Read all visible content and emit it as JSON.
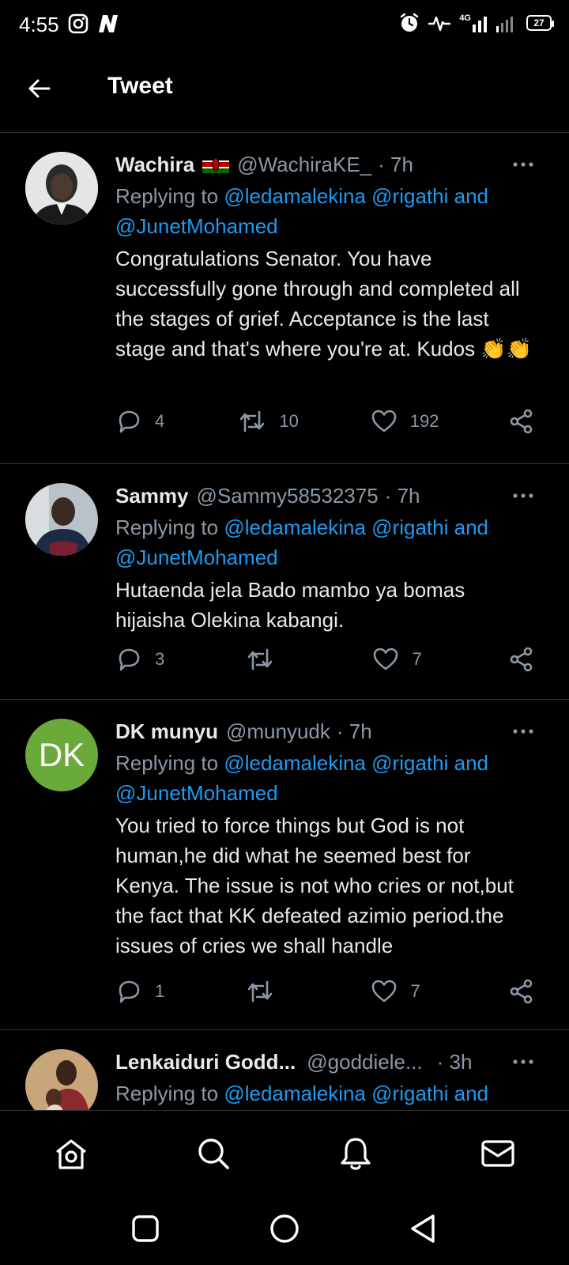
{
  "status_bar": {
    "time": "4:55",
    "network": "4G",
    "battery": "27",
    "icons": [
      "instagram-icon",
      "app-n-icon",
      "alarm-icon",
      "activity-icon",
      "signal-icon",
      "battery-icon"
    ]
  },
  "header": {
    "title": "Tweet",
    "back_icon": "arrow-left-icon"
  },
  "tweets": [
    {
      "name": "Wachira",
      "flag": "kenya-flag",
      "handle": "@WachiraKE_",
      "time": "· 7h",
      "reply_prefix": "Replying to",
      "mention1": "@ledamalekina",
      "mention2": "@rigathi",
      "reply_and": "and",
      "mention3": "@JunetMohamed",
      "body": "Congratulations Senator. You have successfully gone through and completed all the stages of grief. Acceptance is the last stage and that's where you're at. Kudos 👏👏",
      "replies": "4",
      "retweets": "10",
      "likes": "192"
    },
    {
      "name": "Sammy",
      "handle": "@Sammy58532375",
      "time": "· 7h",
      "reply_prefix": "Replying to",
      "mention1": "@ledamalekina",
      "mention2": "@rigathi",
      "reply_and": "and",
      "mention3": "@JunetMohamed",
      "body": "Hutaenda jela Bado mambo ya bomas hijaisha Olekina kabangi.",
      "replies": "3",
      "retweets": "",
      "likes": "7"
    },
    {
      "name": "DK munyu",
      "handle": "@munyudk",
      "time": "· 7h",
      "avatar_initials": "DK",
      "reply_prefix": "Replying to",
      "mention1": "@ledamalekina",
      "mention2": "@rigathi",
      "reply_and": "and",
      "mention3": "@JunetMohamed",
      "body": "You tried to force things but God is not human,he did what he seemed best for Kenya. The issue is not who cries or not,but the fact that KK defeated azimio period.the issues of cries we shall handle",
      "replies": "1",
      "retweets": "",
      "likes": "7"
    },
    {
      "name": "Lenkaiduri Godd...",
      "handle": "@goddiele...",
      "time": "· 3h",
      "reply_prefix": "Replying to",
      "mention1": "@ledamalekina",
      "mention2": "@rigathi",
      "reply_and": "and"
    }
  ],
  "colors": {
    "accent": "#1d9bf0",
    "muted": "#8b98a5",
    "background": "#000000",
    "dk_avatar": "#6aaa3a"
  },
  "bottom_nav": [
    "home-icon",
    "search-icon",
    "notifications-icon",
    "messages-icon"
  ],
  "system_nav": [
    "recents-icon",
    "home-circle-icon",
    "back-triangle-icon"
  ]
}
